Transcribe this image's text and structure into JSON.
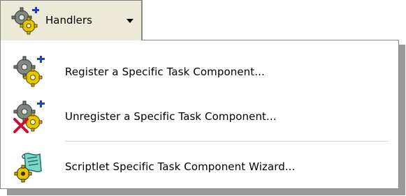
{
  "toolbar": {
    "handlers_label": "Handlers"
  },
  "menu": {
    "items": [
      {
        "label": "Register a Specific Task Component...",
        "icon": "register-handler-icon"
      },
      {
        "label": "Unregister a Specific Task Component...",
        "icon": "unregister-handler-icon"
      },
      {
        "label": "Scriptlet Specific Task Component Wizard...",
        "icon": "scriptlet-wizard-icon"
      }
    ]
  }
}
